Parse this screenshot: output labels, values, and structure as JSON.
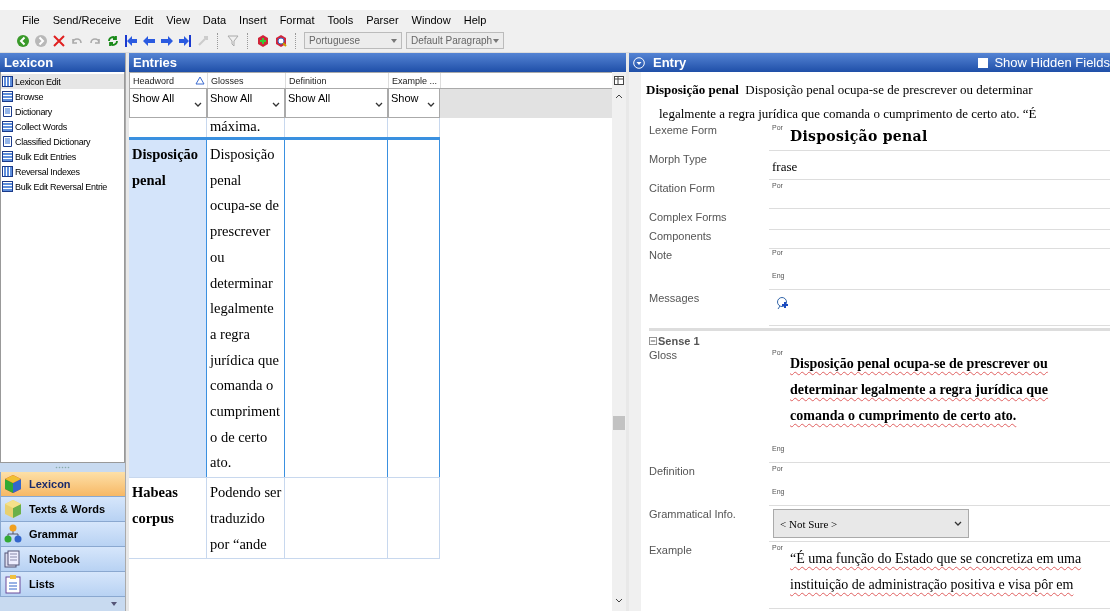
{
  "menu": [
    "File",
    "Send/Receive",
    "Edit",
    "View",
    "Data",
    "Insert",
    "Format",
    "Tools",
    "Parser",
    "Window",
    "Help"
  ],
  "toolbar": {
    "writing_system": "Portuguese",
    "style": "Default Paragraph"
  },
  "sidebar": {
    "title": "Lexicon",
    "items": [
      {
        "label": "Lexicon Edit",
        "kind": "grid",
        "selected": true
      },
      {
        "label": "Browse",
        "kind": "browse",
        "selected": false
      },
      {
        "label": "Dictionary",
        "kind": "doc",
        "selected": false
      },
      {
        "label": "Collect Words",
        "kind": "browse",
        "selected": false
      },
      {
        "label": "Classified Dictionary",
        "kind": "doc",
        "selected": false
      },
      {
        "label": "Bulk Edit Entries",
        "kind": "browse",
        "selected": false
      },
      {
        "label": "Reversal Indexes",
        "kind": "grid",
        "selected": false
      },
      {
        "label": "Bulk Edit Reversal Entrie",
        "kind": "browse",
        "selected": false
      }
    ],
    "areas": [
      {
        "label": "Lexicon",
        "kind": "lexicon",
        "selected": true
      },
      {
        "label": "Texts & Words",
        "kind": "texts",
        "selected": false
      },
      {
        "label": "Grammar",
        "kind": "grammar",
        "selected": false
      },
      {
        "label": "Notebook",
        "kind": "notebook",
        "selected": false
      },
      {
        "label": "Lists",
        "kind": "lists",
        "selected": false
      }
    ]
  },
  "entries": {
    "title": "Entries",
    "columns": [
      {
        "label": "Headword",
        "sorted": true,
        "filter": "Show All"
      },
      {
        "label": "Glosses",
        "sorted": false,
        "filter": "Show All"
      },
      {
        "label": "Definition",
        "sorted": false,
        "filter": "Show All"
      },
      {
        "label": "Example ...",
        "sorted": false,
        "filter": "Show"
      }
    ],
    "rows": [
      {
        "glosses": "máxima.",
        "selected": false
      },
      {
        "headword": "Disposição penal",
        "glosses": "Disposição penal ocupa-se de prescrever ou determinar legalmente a regra jurídica que comanda o cumprimento de certo ato.",
        "selected": true
      },
      {
        "headword": "Habeas corpus",
        "glosses": "Podendo ser traduzido por “ande",
        "selected": false
      }
    ]
  },
  "entry": {
    "title": "Entry",
    "show_hidden_fields": {
      "label": "Show Hidden Fields",
      "checked": false
    },
    "summary": {
      "headword": "Disposição penal",
      "text": "Disposição penal ocupa-se de prescrever ou determinar legalmente a regra jurídica que comanda o cumprimento de certo ato.  “É"
    },
    "fields": [
      {
        "label": "Lexeme Form",
        "kind": "lexeme",
        "lines": [
          {
            "ws": "Por",
            "value": "Disposição penal"
          }
        ]
      },
      {
        "label": "Morph Type",
        "kind": "text",
        "value": "frase"
      },
      {
        "label": "Citation Form",
        "kind": "ws",
        "lines": [
          {
            "ws": "Por"
          }
        ]
      },
      {
        "label": "Complex Forms",
        "kind": "empty"
      },
      {
        "label": "Components",
        "kind": "empty"
      },
      {
        "label": "Note",
        "kind": "ws",
        "lines": [
          {
            "ws": "Por"
          },
          {
            "ws": "Eng"
          }
        ]
      },
      {
        "label": "Messages",
        "kind": "messages"
      }
    ],
    "sense": {
      "label": "Sense 1",
      "expanded": true,
      "fields": [
        {
          "label": "Gloss",
          "kind": "ws",
          "lines": [
            {
              "ws": "Por",
              "value": "Disposição penal ocupa-se de prescrever ou determinar legalmente a regra jurídica que comanda o cumprimento de certo ato.",
              "bold": true
            },
            {
              "ws": "Eng"
            }
          ]
        },
        {
          "label": "Definition",
          "kind": "ws",
          "lines": [
            {
              "ws": "Por"
            },
            {
              "ws": "Eng"
            }
          ]
        },
        {
          "label": "Grammatical Info.",
          "kind": "combo",
          "value": "< Not Sure >"
        },
        {
          "label": "Example",
          "kind": "ws",
          "lines": [
            {
              "ws": "Por",
              "value": "“É uma função do Estado que se concretiza em uma instituição de administração positiva e visa pôr em",
              "bold": false
            }
          ]
        }
      ]
    }
  }
}
